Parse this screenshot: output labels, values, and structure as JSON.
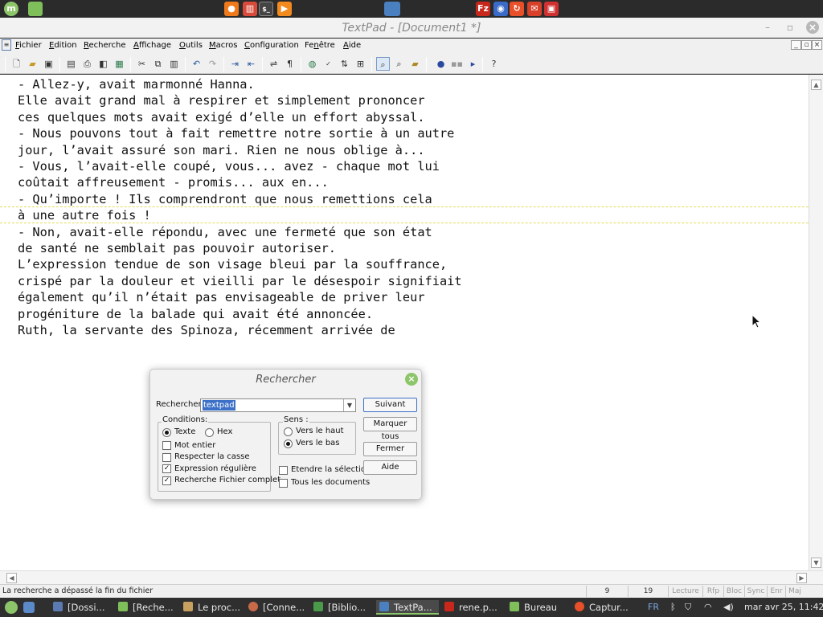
{
  "top_panel": {
    "launchers": [
      "menu-icon",
      "folder-icon",
      "firefox-icon",
      "library-icon",
      "terminal-icon",
      "media-icon",
      "textpad-icon",
      "filezilla-icon",
      "finder-icon",
      "update-icon",
      "mail-icon",
      "backup-icon"
    ],
    "terminal_glyph": "$_"
  },
  "window": {
    "title": "TextPad - [Document1 *]"
  },
  "menu": {
    "items": [
      {
        "u": "F",
        "rest": "ichier"
      },
      {
        "u": "E",
        "rest": "dition"
      },
      {
        "u": "R",
        "rest": "echerche"
      },
      {
        "u": "A",
        "rest": "ffichage"
      },
      {
        "u": "O",
        "rest": "utils"
      },
      {
        "u": "M",
        "rest": "acros"
      },
      {
        "u": "C",
        "rest": "onfiguration"
      },
      {
        "u": "n",
        "pre": "Fe",
        "rest": "être"
      },
      {
        "u": "A",
        "rest": "ide"
      }
    ]
  },
  "toolbar": {
    "buttons": [
      "new-file",
      "open",
      "save",
      "print-list",
      "print",
      "print-preview",
      "spell-doc",
      "cut",
      "copy",
      "paste",
      "undo",
      "redo",
      "indent",
      "outdent",
      "wrap",
      "pilcrow",
      "globe",
      "spellcheck",
      "sort",
      "compare",
      "find",
      "replace",
      "find-files",
      "record",
      "playback",
      "run",
      "help-context"
    ]
  },
  "editor": {
    "lines": [
      "- Allez-y, avait marmonné Hanna.",
      "Elle avait grand mal à respirer et simplement prononcer",
      "ces quelques mots avait exigé d’elle un effort abyssal.",
      "- Nous pouvons tout à fait remettre notre sortie à un autre",
      "jour, l’avait assuré son mari. Rien ne nous oblige à...",
      "- Vous, l’avait-elle coupé, vous... avez - chaque mot lui",
      "coûtait affreusement - promis... aux en...",
      "- Qu’importe ! Ils comprendront que nous remettions cela",
      "à une autre fois !",
      "- Non, avait-elle répondu, avec une fermeté que son état",
      "de santé ne semblait pas pouvoir autoriser.",
      "L’expression tendue de son visage bleui par la souffrance,",
      "crispé par la douleur et vieilli par le désespoir signifiait",
      "également qu’il n’était pas envisageable de priver leur",
      "progéniture de la balade qui avait été annoncée.",
      "Ruth, la servante des Spinoza, récemment arrivée de"
    ]
  },
  "find_dialog": {
    "title": "Rechercher",
    "search_label": "Rechercher",
    "search_value": "textpad",
    "conditions_legend": "Conditions:",
    "radio_text": "Texte",
    "radio_hex": "Hex",
    "checkboxes": [
      {
        "label": "Mot entier",
        "checked": ""
      },
      {
        "label": "Respecter la casse",
        "checked": ""
      },
      {
        "label": "Expression régulière",
        "checked": "✓"
      },
      {
        "label": "Recherche Fichier complet",
        "checked": "✓"
      }
    ],
    "sens_legend": "Sens :",
    "radio_up": "Vers le haut",
    "radio_down": "Vers le bas",
    "extend_selection": "Etendre la sélection",
    "all_documents": "Tous les documents",
    "btn_next": "Suivant",
    "btn_mark_all": "Marquer tous",
    "btn_close": "Fermer",
    "btn_help": "Aide"
  },
  "status": {
    "message": "La recherche a dépassé la fin du fichier",
    "line": "9",
    "col": "19",
    "mode": "Lecture",
    "rfp": "Rfp",
    "bloc": "Bloc",
    "sync": "Sync",
    "enr": "Enr",
    "maj": "Maj"
  },
  "taskbar": {
    "tasks": [
      "[Dossi...",
      "[Reche...",
      "Le proc...",
      "[Conne...",
      "[Biblio...",
      "TextPa...",
      "rene.p...",
      "Bureau",
      "Captur..."
    ],
    "lang": "FR",
    "clock": "mar avr 25, 11:42"
  },
  "colors": {
    "accent_green": "#8cc56a",
    "selection_blue": "#3c70c8",
    "current_line": "#e4dc5a"
  }
}
